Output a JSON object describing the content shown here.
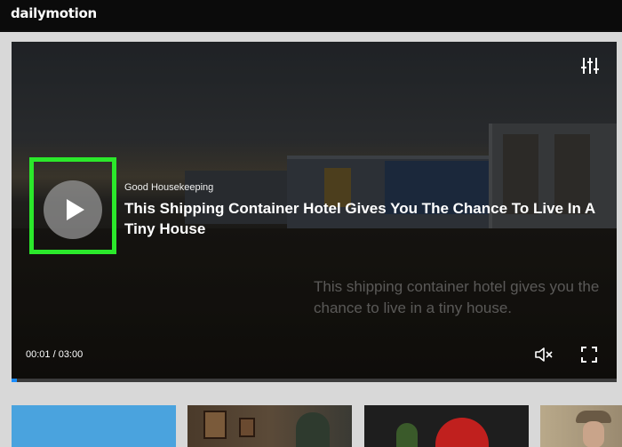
{
  "app": {
    "logo_text": "dailymotion"
  },
  "player": {
    "source": "Good Housekeeping",
    "title": "This Shipping Container Hotel Gives You The Chance To Live In A Tiny House",
    "burned_in_caption": "This shipping container hotel gives you the chance to live in a tiny house.",
    "time_display": "00:01 / 03:00",
    "progress_fraction": 0.006,
    "progress_color": "#1a8dff",
    "highlight_color": "#2be82b",
    "icons": {
      "settings": "settings-sliders-icon",
      "play": "play-icon",
      "mute": "volume-muted-icon",
      "fullscreen": "fullscreen-icon"
    }
  },
  "recommendations": [
    {
      "id": "thumb-1"
    },
    {
      "id": "thumb-2"
    },
    {
      "id": "thumb-3"
    },
    {
      "id": "thumb-4"
    }
  ]
}
